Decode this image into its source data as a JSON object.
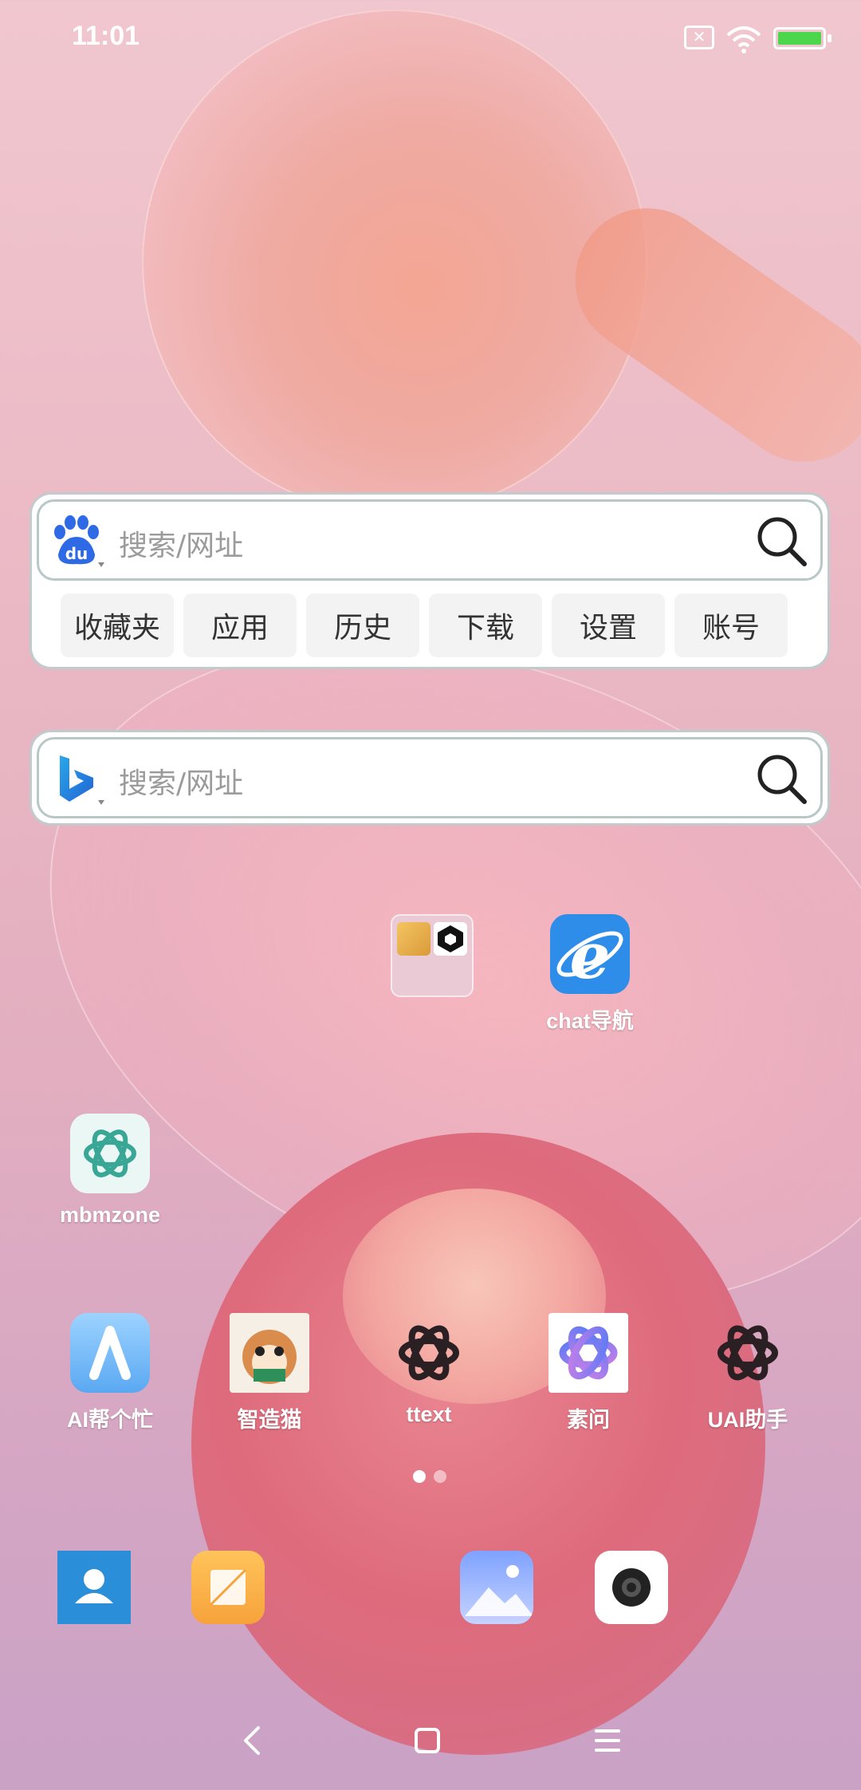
{
  "status_bar": {
    "time": "11:01"
  },
  "search_widgets": {
    "baidu": {
      "placeholder": "搜索/网址",
      "chips": [
        "收藏夹",
        "应用",
        "历史",
        "下载",
        "设置",
        "账号"
      ]
    },
    "bing": {
      "placeholder": "搜索/网址"
    }
  },
  "home_apps": {
    "chat_nav": "chat导航",
    "mbmzone": "mbmzone",
    "ai_help": "AI帮个忙",
    "zhizaomao": "智造猫",
    "ttext": "ttext",
    "suwen": "素问",
    "uai": "UAI助手"
  },
  "page_indicator": {
    "current": 1,
    "total": 2
  },
  "icons": {
    "status": [
      "sim-off-icon",
      "wifi-icon",
      "battery-charging-icon"
    ],
    "dock": [
      "contacts-icon",
      "notes-icon",
      "gallery-icon",
      "camera-icon"
    ],
    "nav": [
      "back-icon",
      "home-icon",
      "menu-icon"
    ]
  }
}
